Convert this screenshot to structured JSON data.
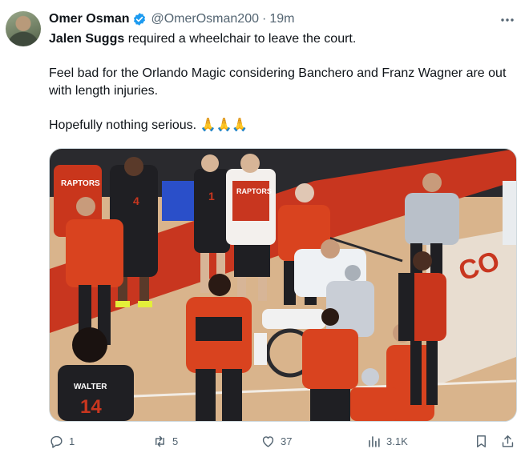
{
  "author": {
    "name": "Omer Osman",
    "handle": "@OmerOsman200",
    "time": "19m"
  },
  "tweet": {
    "mention": "Jalen Suggs",
    "line1_rest": " required a wheelchair to leave the court.",
    "para2": "Feel bad for the Orlando Magic considering Banchero and Franz Wagner are out with length injuries.",
    "para3": "Hopefully nothing serious. 🙏🙏🙏"
  },
  "media": {
    "description_colors": {
      "court": "#d7b38c",
      "red_band": "#c8361f",
      "jersey_red": "#c9361c"
    },
    "visible_text": {
      "jersey_1": "RAPTORS",
      "jersey_2": "RAPTORS",
      "jersey_3": "WALTER",
      "number_1": "4",
      "number_2": "1",
      "number_3": "14",
      "court_letters": "CO"
    }
  },
  "actions": {
    "reply_count": "1",
    "retweet_count": "5",
    "like_count": "37",
    "view_count": "3.1K"
  },
  "colors": {
    "muted": "#536471",
    "verified": "#1d9bf0"
  }
}
